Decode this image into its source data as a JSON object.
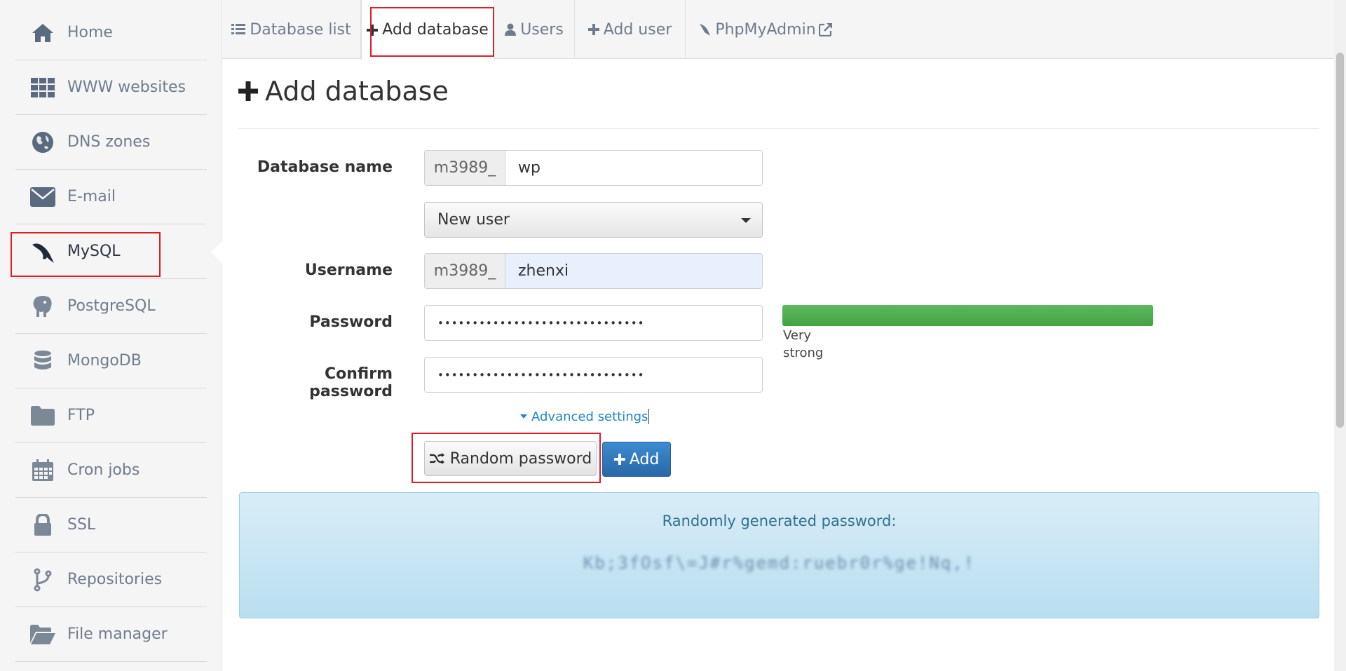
{
  "sidebar": {
    "items": [
      {
        "label": "Home",
        "icon": "home-icon"
      },
      {
        "label": "WWW websites",
        "icon": "grid-icon"
      },
      {
        "label": "DNS zones",
        "icon": "globe-icon"
      },
      {
        "label": "E-mail",
        "icon": "envelope-icon"
      },
      {
        "label": "MySQL",
        "icon": "mysql-dolphin-icon"
      },
      {
        "label": "PostgreSQL",
        "icon": "postgresql-elephant-icon"
      },
      {
        "label": "MongoDB",
        "icon": "database-icon"
      },
      {
        "label": "FTP",
        "icon": "folder-icon"
      },
      {
        "label": "Cron jobs",
        "icon": "calendar-icon"
      },
      {
        "label": "SSL",
        "icon": "lock-icon"
      },
      {
        "label": "Repositories",
        "icon": "git-branch-icon"
      },
      {
        "label": "File manager",
        "icon": "folder-open-icon"
      }
    ],
    "active": "MySQL"
  },
  "tabs": [
    {
      "label": "Database list",
      "icon": "list-icon"
    },
    {
      "label": "Add database",
      "icon": "plus-icon"
    },
    {
      "label": "Users",
      "icon": "user-icon"
    },
    {
      "label": "Add user",
      "icon": "plus-icon"
    },
    {
      "label": "PhpMyAdmin",
      "icon": "external-link-icon"
    }
  ],
  "page": {
    "title": "Add database"
  },
  "form": {
    "db_name_label": "Database name",
    "db_prefix": "m3989_",
    "db_name_value": "wp",
    "user_select_value": "New user",
    "username_label": "Username",
    "username_prefix": "m3989_",
    "username_value": "zhenxi",
    "password_label": "Password",
    "password_value": "••••••••••••••••••••••••••••••",
    "confirm_label": "Confirm password",
    "confirm_value": "••••••••••••••••••••••••••••••",
    "strength_label": "Very strong",
    "strength_level": 1.0,
    "advanced_label": "Advanced settings",
    "random_button": "Random password",
    "add_button": "Add"
  },
  "alert": {
    "title": "Randomly generated password:",
    "password_masked": "Kb;3fOsf\\=J#r%gemd:ruebr0r%ge!Nq,!"
  },
  "colors": {
    "highlight": "#d9202a",
    "primary": "#2868a8",
    "success": "#5cb85c",
    "info_bg": "#d9edf7",
    "link": "#1f86c5"
  }
}
